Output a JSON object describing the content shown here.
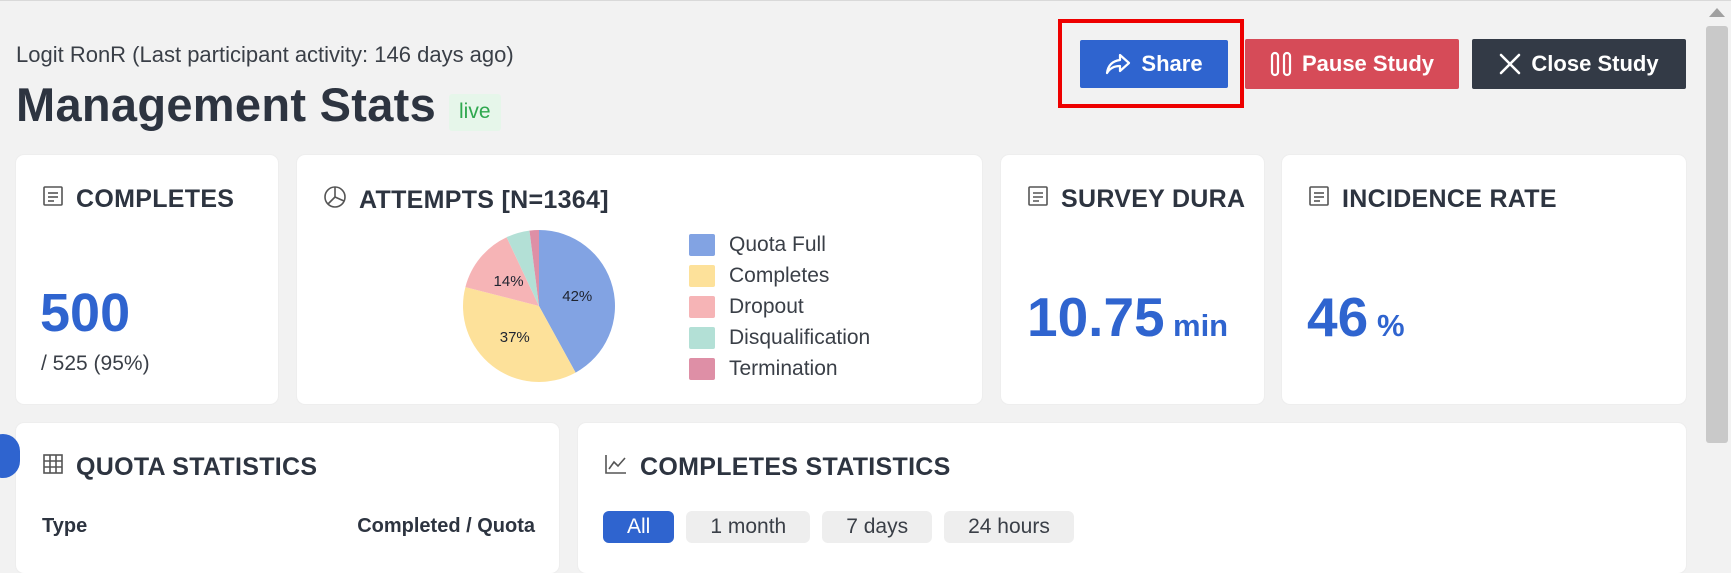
{
  "header": {
    "subtitle": "Logit RonR (Last participant activity: 146 days ago)",
    "title": "Management Stats",
    "status_badge": "live"
  },
  "actions": {
    "share_label": "Share",
    "pause_label": "Pause Study",
    "close_label": "Close Study"
  },
  "completes": {
    "title": "COMPLETES",
    "value": "500",
    "detail": "/ 525 (95%)"
  },
  "attempts": {
    "title": "ATTEMPTS [N=1364]"
  },
  "survey_duration": {
    "title": "SURVEY DURA",
    "value": "10.75",
    "unit": "min"
  },
  "incidence_rate": {
    "title": "INCIDENCE RATE",
    "value": "46",
    "unit": "%"
  },
  "quota_statistics": {
    "title": "QUOTA STATISTICS",
    "columns": [
      "Type",
      "Completed / Quota"
    ]
  },
  "completes_statistics": {
    "title": "COMPLETES STATISTICS",
    "filters": [
      "All",
      "1 month",
      "7 days",
      "24 hours"
    ],
    "active_filter": "All"
  },
  "chart_data": {
    "type": "pie",
    "title": "ATTEMPTS [N=1364]",
    "categories": [
      "Quota Full",
      "Completes",
      "Dropout",
      "Disqualification",
      "Termination"
    ],
    "values": [
      42,
      37,
      14,
      5,
      2
    ],
    "labels": [
      "42%",
      "37%",
      "14%",
      "",
      ""
    ],
    "colors": [
      "#82a3e3",
      "#fde19a",
      "#f6b4b6",
      "#b3e0d6",
      "#de8fa6"
    ],
    "legend_position": "right"
  },
  "icons": {
    "share": "share-arrow-icon",
    "pause": "pause-icon",
    "close": "close-x-icon",
    "card": "document-list-icon",
    "pie": "pie-chart-icon",
    "table": "table-grid-icon",
    "line": "line-chart-icon"
  },
  "colors": {
    "primary": "#2f64cf",
    "danger": "#d64b58",
    "dark": "#333a46",
    "live_green": "#2fa84f",
    "highlight_red": "#ee0000"
  }
}
